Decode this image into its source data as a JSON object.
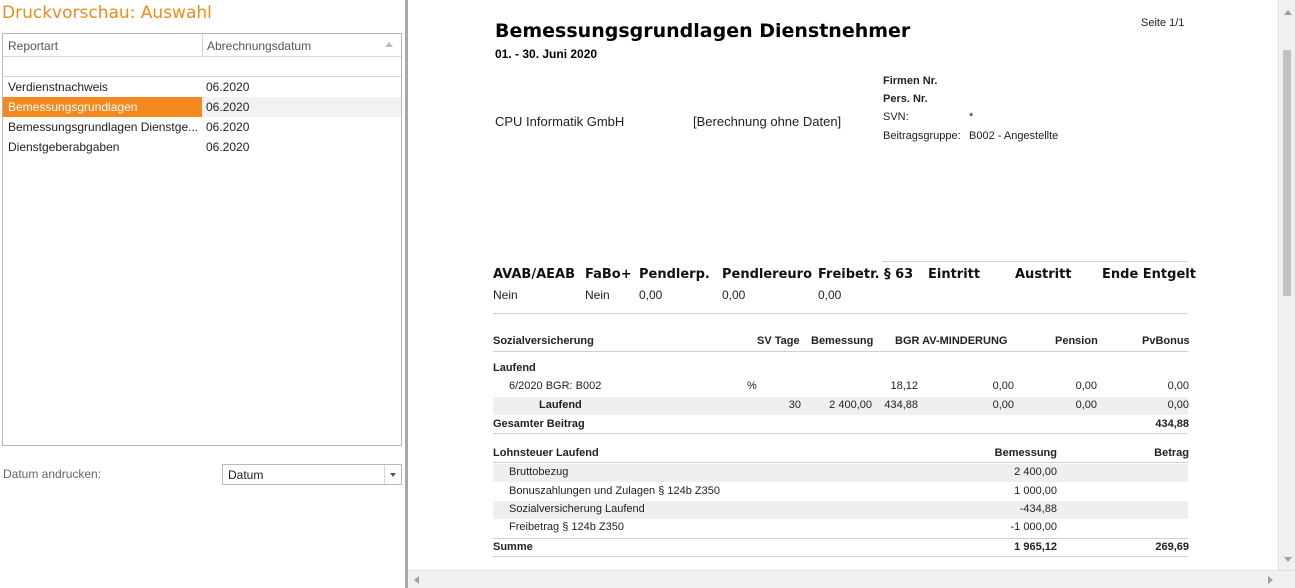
{
  "left": {
    "title": "Druckvorschau: Auswahl",
    "columns": [
      "Reportart",
      "Abrechnungsdatum"
    ],
    "rows": [
      {
        "report": "Verdienstnachweis",
        "date": "06.2020"
      },
      {
        "report": "Bemessungsgrundlagen",
        "date": "06.2020"
      },
      {
        "report": "Bemessungsgrundlagen Dienstge...",
        "date": "06.2020"
      },
      {
        "report": "Dienstgeberabgaben",
        "date": "06.2020"
      }
    ],
    "selected_index": 1,
    "datum_label": "Datum andrucken:",
    "datum_value": "Datum",
    "accent_color": "#f5891f"
  },
  "report": {
    "title": "Bemessungsgrundlagen Dienstnehmer",
    "period": "01. - 30. Juni 2020",
    "page": "Seite 1/1",
    "company": "CPU Informatik GmbH",
    "calc_note": "[Berechnung ohne Daten]",
    "info": {
      "firmen_label": "Firmen Nr.",
      "pers_label": "Pers. Nr.",
      "svn_label": "SVN:",
      "svn_value": "*",
      "beitrag_label": "Beitragsgruppe:",
      "beitrag_value": "B002 - Angestellte"
    },
    "flags": {
      "headers": [
        "AVAB/AEAB",
        "FaBo+",
        "Pendlerp.",
        "Pendlereuro",
        "Freibetr. § 63",
        "Eintritt",
        "Austritt",
        "Ende Entgelt"
      ],
      "values": [
        "Nein",
        "Nein",
        "0,00",
        "0,00",
        "0,00"
      ]
    },
    "sv": {
      "headers": [
        "Sozialversicherung",
        "SV Tage",
        "Bemessung",
        "BGR AV-MINDERUNG",
        "Pension",
        "PvBonus"
      ],
      "group": "Laufend",
      "row1": {
        "label": "6/2020 BGR: B002",
        "pct": "%",
        "bgr": "18,12",
        "av": "0,00",
        "pension": "0,00",
        "pvbonus": "0,00"
      },
      "row2": {
        "label": "Laufend",
        "tage": "30",
        "bemessung": "2 400,00",
        "bgr": "434,88",
        "av": "0,00",
        "pension": "0,00",
        "pvbonus": "0,00"
      },
      "total_label": "Gesamter Beitrag",
      "total_value": "434,88"
    },
    "lst": {
      "headers": [
        "Lohnsteuer Laufend",
        "Bemessung",
        "Betrag"
      ],
      "rows": [
        {
          "label": "Bruttobezug",
          "value": "2 400,00"
        },
        {
          "label": "Bonuszahlungen und Zulagen § 124b Z350",
          "value": "1 000,00"
        },
        {
          "label": "Sozialversicherung Laufend",
          "value": "-434,88"
        },
        {
          "label": "Freibetrag § 124b Z350",
          "value": "-1 000,00"
        }
      ],
      "sum_label": "Summe",
      "sum_bemessung": "1 965,12",
      "sum_betrag": "269,69"
    }
  }
}
